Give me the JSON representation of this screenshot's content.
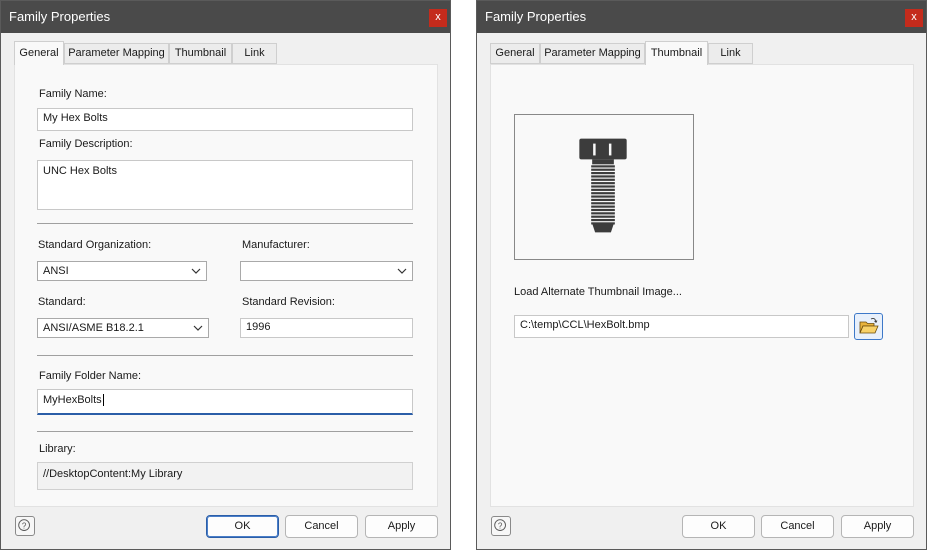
{
  "left_dialog": {
    "title": "Family Properties",
    "close_label": "x",
    "tabs": [
      "General",
      "Parameter Mapping",
      "Thumbnail",
      "Link"
    ],
    "active_tab": "General",
    "family_name_label": "Family Name:",
    "family_name_value": "My Hex Bolts",
    "family_description_label": "Family Description:",
    "family_description_value": "UNC Hex Bolts",
    "standard_org_label": "Standard Organization:",
    "standard_org_value": "ANSI",
    "manufacturer_label": "Manufacturer:",
    "manufacturer_value": "",
    "standard_label": "Standard:",
    "standard_value": "ANSI/ASME B18.2.1",
    "standard_revision_label": "Standard Revision:",
    "standard_revision_value": "1996",
    "folder_name_label": "Family Folder Name:",
    "folder_name_value": "MyHexBolts",
    "library_label": "Library:",
    "library_value": "//DesktopContent:My Library",
    "buttons": {
      "ok": "OK",
      "cancel": "Cancel",
      "apply": "Apply"
    }
  },
  "right_dialog": {
    "title": "Family Properties",
    "close_label": "x",
    "tabs": [
      "General",
      "Parameter Mapping",
      "Thumbnail",
      "Link"
    ],
    "active_tab": "Thumbnail",
    "load_alt_label": "Load Alternate Thumbnail Image...",
    "thumbnail_path": "C:\\temp\\CCL\\HexBolt.bmp",
    "buttons": {
      "ok": "OK",
      "cancel": "Cancel",
      "apply": "Apply"
    }
  },
  "colors": {
    "titlebar": "#4a4a4a",
    "close": "#c42b1c",
    "focus_accent": "#2b5ea8",
    "bolt": "#3c3c3c"
  },
  "icons": [
    "close-icon",
    "help-icon",
    "chevron-down-icon",
    "folder-open-icon",
    "hex-bolt-thumbnail"
  ]
}
